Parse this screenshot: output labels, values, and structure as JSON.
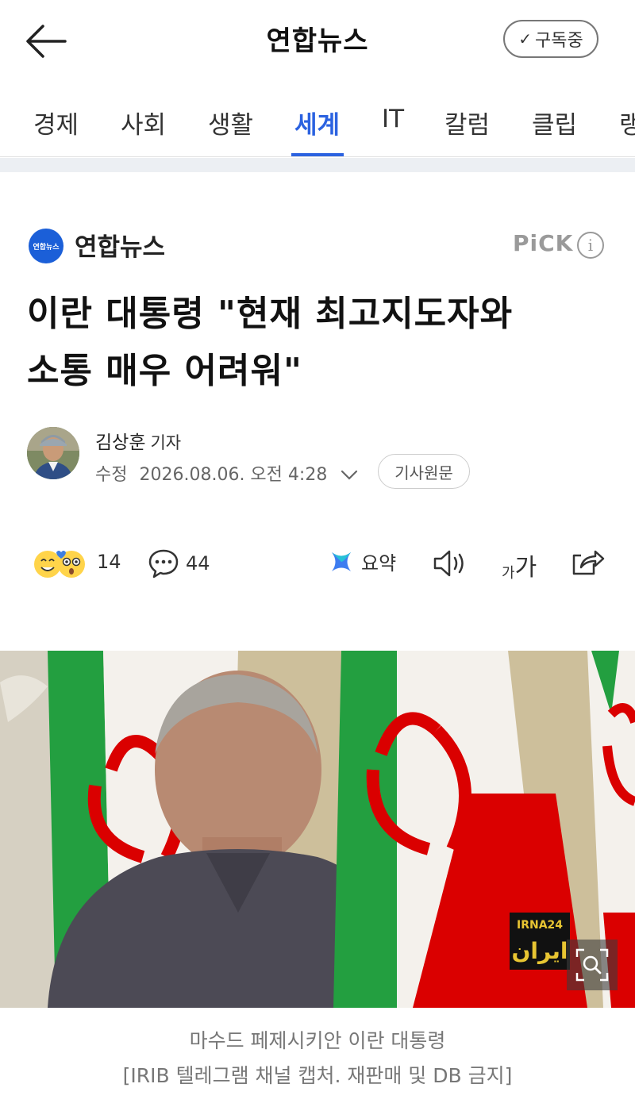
{
  "header": {
    "title": "연합뉴스",
    "subscribe_label": "구독중",
    "check_glyph": "✓"
  },
  "tabs": [
    {
      "label": "경제",
      "active": false
    },
    {
      "label": "사회",
      "active": false
    },
    {
      "label": "생활",
      "active": false
    },
    {
      "label": "세계",
      "active": true
    },
    {
      "label": "IT",
      "active": false
    },
    {
      "label": "칼럼",
      "active": false
    },
    {
      "label": "클립",
      "active": false
    },
    {
      "label": "랭",
      "active": false
    }
  ],
  "press": {
    "logo_text": "연합뉴스",
    "name": "연합뉴스",
    "pick_label": "PiCK",
    "info_glyph": "i"
  },
  "article": {
    "headline_line1": "이란 대통령 \"현재 최고지도자와",
    "headline_line2": "소통 매우 어려워\"",
    "author_name": "김상훈",
    "author_role": "기자",
    "modified_label": "수정",
    "modified_datetime": "2026.08.06. 오전 4:28",
    "original_button": "기사원문"
  },
  "actions": {
    "reaction_count": "14",
    "comment_count": "44",
    "summary_label": "요약",
    "font_small": "가",
    "font_large": "가"
  },
  "photo": {
    "watermark_top": "IRNA24",
    "watermark_bottom": "ایران"
  },
  "caption": {
    "line1": "마수드 페제시키안 이란 대통령",
    "line2": "[IRIB 텔레그램 채널 캡처. 재판매 및 DB 금지]"
  },
  "colors": {
    "accent": "#2b62e0",
    "press_logo": "#1b5fd8",
    "flag_green": "#239f40",
    "flag_red": "#da0000"
  },
  "icons": [
    "back-arrow-icon",
    "check-icon",
    "info-icon",
    "reaction-emoji-icon",
    "comment-icon",
    "summary-sparkle-icon",
    "speaker-icon",
    "font-size-icon",
    "share-icon",
    "zoom-icon"
  ]
}
